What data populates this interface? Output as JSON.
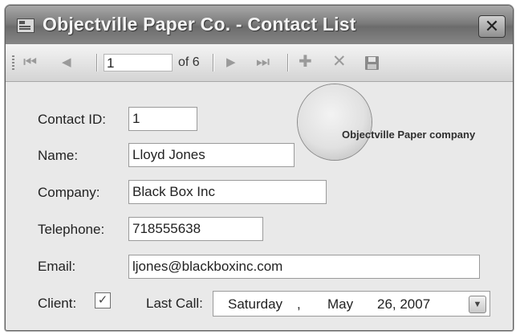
{
  "window": {
    "title": "Objectville Paper Co. - Contact List",
    "close_glyph": "✕"
  },
  "toolbar": {
    "first_glyph": "⏮",
    "prev_glyph": "◀",
    "position": "1",
    "of_label": "of 6",
    "next_glyph": "▶",
    "last_glyph": "⏭",
    "add_glyph": "✚",
    "delete_glyph": "✕",
    "icons": [
      "move-first-icon",
      "move-previous-icon",
      "move-next-icon",
      "move-last-icon",
      "add-new-icon",
      "delete-icon",
      "save-icon"
    ]
  },
  "form": {
    "contact_id_label": "Contact ID:",
    "contact_id_value": "1",
    "name_label": "Name:",
    "name_value": "Lloyd Jones",
    "company_label": "Company:",
    "company_value": "Black Box Inc",
    "telephone_label": "Telephone:",
    "telephone_value": "718555638",
    "email_label": "Email:",
    "email_value": "ljones@blackboxinc.com",
    "client_label": "Client:",
    "client_checked": "✓",
    "last_call_label": "Last Call:",
    "last_call": {
      "weekday": "Saturday",
      "sep": ",",
      "month": "May",
      "day_year": "26, 2007",
      "dropdown_glyph": "▼"
    }
  },
  "logo": {
    "text": "Objectville Paper company"
  }
}
